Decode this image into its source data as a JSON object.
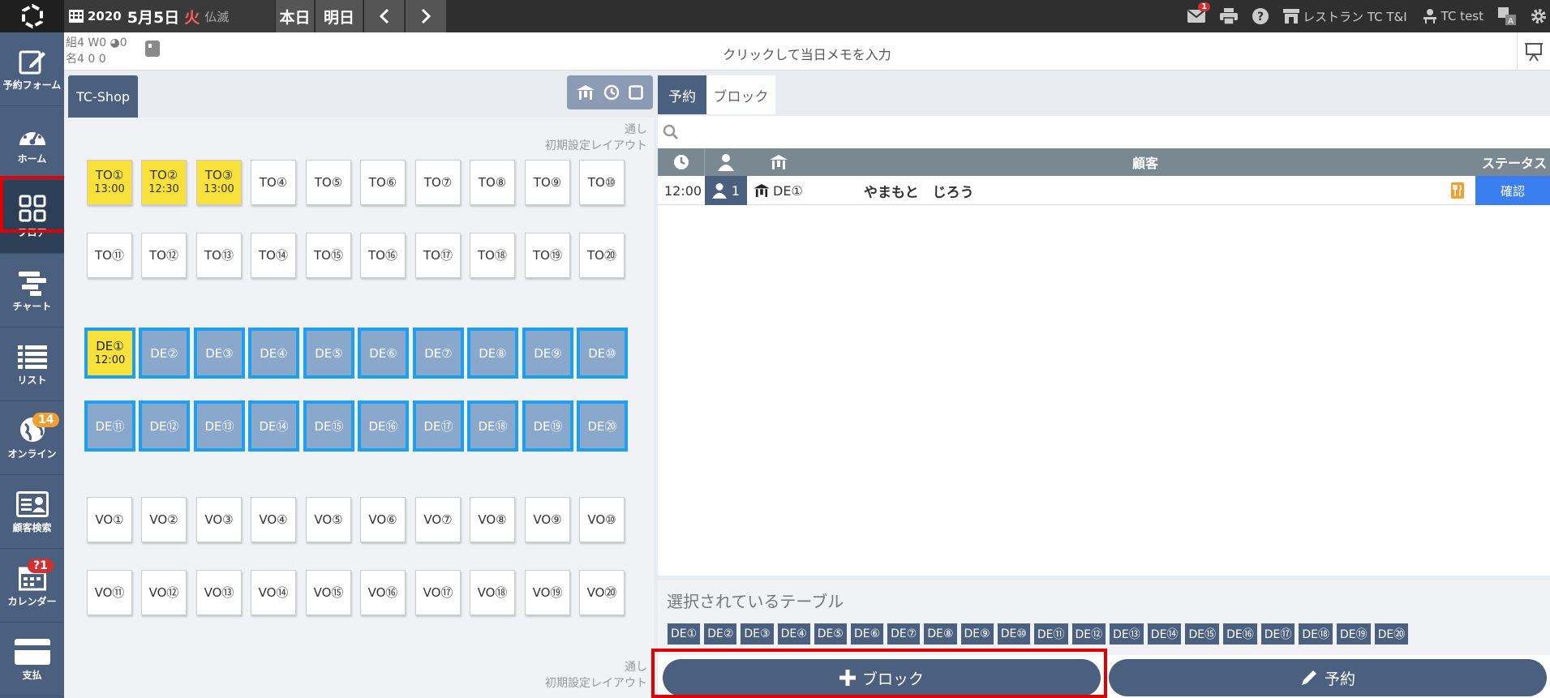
{
  "topbar": {
    "year": "2020",
    "date": "5月5日",
    "weekday": "火",
    "rokuyo": "仏滅",
    "today_btn": "本日",
    "tomorrow_btn": "明日",
    "mail_badge": "1",
    "restaurant": "レストラン TC T&I",
    "user": "TC test"
  },
  "sidebar": [
    {
      "label": "予約フォーム",
      "icon": "edit-icon"
    },
    {
      "label": "ホーム",
      "icon": "dashboard-icon"
    },
    {
      "label": "フロア",
      "icon": "floor-grid-icon"
    },
    {
      "label": "チャート",
      "icon": "chart-icon"
    },
    {
      "label": "リスト",
      "icon": "list-icon"
    },
    {
      "label": "オンライン",
      "icon": "globe-icon",
      "badge": "14"
    },
    {
      "label": "顧客検索",
      "icon": "customer-card-icon"
    },
    {
      "label": "カレンダー",
      "icon": "calendar-icon",
      "badge": "?1"
    },
    {
      "label": "支払",
      "icon": "payment-card-icon"
    }
  ],
  "memo": {
    "stats_line1": "組4 W0 ◕0",
    "stats_line2": "名4   0   0",
    "placeholder": "クリックして当日メモを入力"
  },
  "floor": {
    "shop_tab": "TC-Shop",
    "note_line1": "通し",
    "note_line2": "初期設定レイアウト",
    "rows": [
      [
        {
          "name": "TO①",
          "time": "13:00",
          "booked": true
        },
        {
          "name": "TO②",
          "time": "12:30",
          "booked": true
        },
        {
          "name": "TO③",
          "time": "13:00",
          "booked": true
        },
        {
          "name": "TO④"
        },
        {
          "name": "TO⑤"
        },
        {
          "name": "TO⑥"
        },
        {
          "name": "TO⑦"
        },
        {
          "name": "TO⑧"
        },
        {
          "name": "TO⑨"
        },
        {
          "name": "TO⑩"
        }
      ],
      [
        {
          "name": "TO⑪"
        },
        {
          "name": "TO⑫"
        },
        {
          "name": "TO⑬"
        },
        {
          "name": "TO⑭"
        },
        {
          "name": "TO⑮"
        },
        {
          "name": "TO⑯"
        },
        {
          "name": "TO⑰"
        },
        {
          "name": "TO⑱"
        },
        {
          "name": "TO⑲"
        },
        {
          "name": "TO⑳"
        }
      ],
      [
        {
          "name": "DE①",
          "time": "12:00",
          "booked": true,
          "de": true
        },
        {
          "name": "DE②",
          "de": true
        },
        {
          "name": "DE③",
          "de": true
        },
        {
          "name": "DE④",
          "de": true
        },
        {
          "name": "DE⑤",
          "de": true
        },
        {
          "name": "DE⑥",
          "de": true
        },
        {
          "name": "DE⑦",
          "de": true
        },
        {
          "name": "DE⑧",
          "de": true
        },
        {
          "name": "DE⑨",
          "de": true
        },
        {
          "name": "DE⑩",
          "de": true
        }
      ],
      [
        {
          "name": "DE⑪",
          "de": true
        },
        {
          "name": "DE⑫",
          "de": true
        },
        {
          "name": "DE⑬",
          "de": true
        },
        {
          "name": "DE⑭",
          "de": true
        },
        {
          "name": "DE⑮",
          "de": true
        },
        {
          "name": "DE⑯",
          "de": true
        },
        {
          "name": "DE⑰",
          "de": true
        },
        {
          "name": "DE⑱",
          "de": true
        },
        {
          "name": "DE⑲",
          "de": true
        },
        {
          "name": "DE⑳",
          "de": true
        }
      ],
      [
        {
          "name": "VO①"
        },
        {
          "name": "VO②"
        },
        {
          "name": "VO③"
        },
        {
          "name": "VO④"
        },
        {
          "name": "VO⑤"
        },
        {
          "name": "VO⑥"
        },
        {
          "name": "VO⑦"
        },
        {
          "name": "VO⑧"
        },
        {
          "name": "VO⑨"
        },
        {
          "name": "VO⑩"
        }
      ],
      [
        {
          "name": "VO⑪"
        },
        {
          "name": "VO⑫"
        },
        {
          "name": "VO⑬"
        },
        {
          "name": "VO⑭"
        },
        {
          "name": "VO⑮"
        },
        {
          "name": "VO⑯"
        },
        {
          "name": "VO⑰"
        },
        {
          "name": "VO⑱"
        },
        {
          "name": "VO⑲"
        },
        {
          "name": "VO⑳"
        }
      ]
    ]
  },
  "right": {
    "tab_reservation": "予約",
    "tab_block": "ブロック",
    "header_customer": "顧客",
    "header_status": "ステータス",
    "reservation": {
      "time": "12:00",
      "guests": "1",
      "table": "DE①",
      "customer": "やまもと　じろう",
      "status": "確認"
    },
    "selected_title": "選択されているテーブル",
    "selected_tables": [
      "DE①",
      "DE②",
      "DE③",
      "DE④",
      "DE⑤",
      "DE⑥",
      "DE⑦",
      "DE⑧",
      "DE⑨",
      "DE⑩",
      "DE⑪",
      "DE⑫",
      "DE⑬",
      "DE⑭",
      "DE⑮",
      "DE⑯",
      "DE⑰",
      "DE⑱",
      "DE⑲",
      "DE⑳"
    ],
    "block_button": "ブロック",
    "reserve_button": "予約"
  },
  "colors": {
    "sidebar": "#4b607e",
    "highlight": "#e00000",
    "booked": "#f7e13a",
    "de_table": "#8aa7cc",
    "de_border": "#1ea0f0",
    "status": "#3b7ef0"
  }
}
